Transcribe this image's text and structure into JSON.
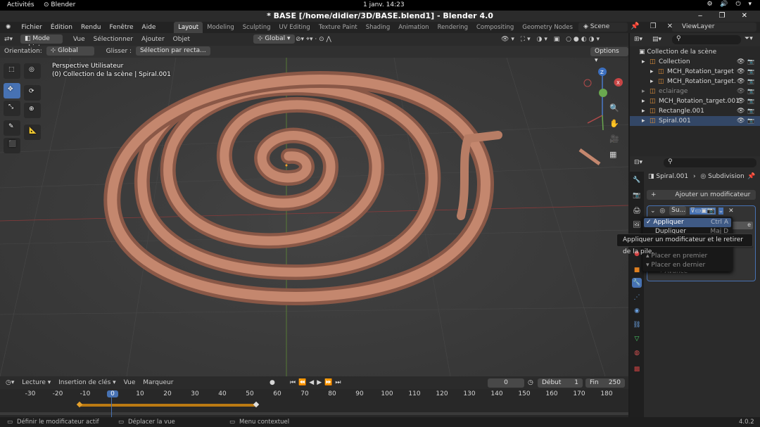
{
  "gnome": {
    "activities": "Activités",
    "app_name": "Blender",
    "clock": "1 janv.  14:23",
    "tray": "⚙ 🔊 ⏻ ▾"
  },
  "window": {
    "title": "* BASE [/home/didier/3D/BASE.blend1] - Blender 4.0",
    "controls": "‒ ❐ ✕"
  },
  "menu": [
    "Fichier",
    "Édition",
    "Rendu",
    "Fenêtre",
    "Aide"
  ],
  "workspaces": [
    {
      "label": "Layout",
      "active": true
    },
    {
      "label": "Modeling"
    },
    {
      "label": "Sculpting"
    },
    {
      "label": "UV Editing"
    },
    {
      "label": "Texture Paint"
    },
    {
      "label": "Shading"
    },
    {
      "label": "Animation"
    },
    {
      "label": "Rendering"
    },
    {
      "label": "Compositing"
    },
    {
      "label": "Geometry Nodes"
    },
    {
      "label": "Scripting"
    }
  ],
  "scene": {
    "label": "Scene",
    "viewlayer": "ViewLayer"
  },
  "viewport": {
    "header": {
      "mode": "Mode objet",
      "menus": [
        "Vue",
        "Sélectionner",
        "Ajouter",
        "Objet"
      ],
      "transform": "Global"
    },
    "toolbar": {
      "orientation_label": "Orientation:",
      "orientation": "Global",
      "drag_label": "Glisser :",
      "drag": "Sélection par recta...",
      "options": "Options"
    },
    "overlay": {
      "perspective": "Perspective Utilisateur",
      "collection": "(0) Collection de la scène | Spiral.001"
    },
    "gizmo": {
      "z": "Z",
      "y": "Y",
      "x": "X"
    }
  },
  "timeline": {
    "header": {
      "playback": "Lecture",
      "keying": "Insertion de clés",
      "view": "Vue",
      "marker": "Marqueur",
      "current_frame": "0",
      "start_label": "Début",
      "start": "1",
      "end_label": "Fin",
      "end": "250"
    },
    "ticks": [
      "-30",
      "-20",
      "-10",
      "0",
      "10",
      "20",
      "30",
      "40",
      "50",
      "60",
      "70",
      "80",
      "90",
      "100",
      "110",
      "120",
      "130",
      "140",
      "150",
      "160",
      "170",
      "180"
    ]
  },
  "status": {
    "left": "Définir le modificateur actif",
    "middle": "Déplacer la vue",
    "right": "Menu contextuel",
    "version": "4.0.2"
  },
  "outliner": {
    "root": "Collection de la scène",
    "items": [
      {
        "label": "Collection",
        "indent": 1
      },
      {
        "label": "MCH_Rotation_target",
        "indent": 2
      },
      {
        "label": "MCH_Rotation_target.",
        "indent": 2
      },
      {
        "label": "eclairage",
        "indent": 1,
        "dim": true
      },
      {
        "label": "MCH_Rotation_target.001",
        "indent": 1
      },
      {
        "label": "Rectangle.001",
        "indent": 1
      },
      {
        "label": "Spiral.001",
        "indent": 1,
        "selected": true
      }
    ]
  },
  "properties": {
    "breadcrumb_object": "Spiral.001",
    "breadcrumb_modifier": "Subdivision",
    "add_modifier": "Ajouter un modificateur",
    "modifier_name": "Su...",
    "advanced": "Avancé"
  },
  "context_menu": {
    "apply": "Appliquer",
    "apply_shortcut": "Ctrl A",
    "duplicate": "Dupliquer",
    "duplicate_shortcut": "Maj D",
    "move_first": "Placer en premier",
    "move_last": "Placer en dernier"
  },
  "tooltip": "Appliquer un modificateur et le retirer de la pile."
}
